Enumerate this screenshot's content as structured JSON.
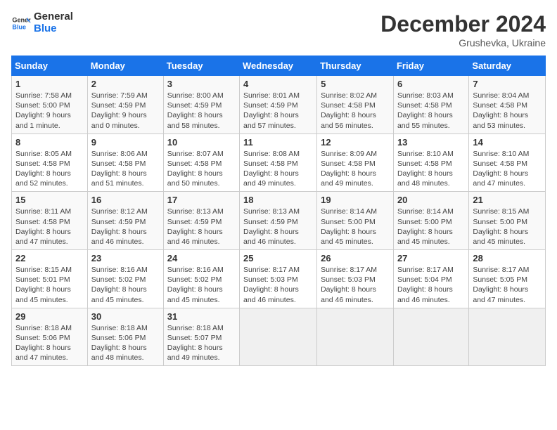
{
  "header": {
    "logo_line1": "General",
    "logo_line2": "Blue",
    "month": "December 2024",
    "location": "Grushevka, Ukraine"
  },
  "days_of_week": [
    "Sunday",
    "Monday",
    "Tuesday",
    "Wednesday",
    "Thursday",
    "Friday",
    "Saturday"
  ],
  "weeks": [
    [
      {
        "day": 1,
        "detail": "Sunrise: 7:58 AM\nSunset: 5:00 PM\nDaylight: 9 hours\nand 1 minute."
      },
      {
        "day": 2,
        "detail": "Sunrise: 7:59 AM\nSunset: 4:59 PM\nDaylight: 9 hours\nand 0 minutes."
      },
      {
        "day": 3,
        "detail": "Sunrise: 8:00 AM\nSunset: 4:59 PM\nDaylight: 8 hours\nand 58 minutes."
      },
      {
        "day": 4,
        "detail": "Sunrise: 8:01 AM\nSunset: 4:59 PM\nDaylight: 8 hours\nand 57 minutes."
      },
      {
        "day": 5,
        "detail": "Sunrise: 8:02 AM\nSunset: 4:58 PM\nDaylight: 8 hours\nand 56 minutes."
      },
      {
        "day": 6,
        "detail": "Sunrise: 8:03 AM\nSunset: 4:58 PM\nDaylight: 8 hours\nand 55 minutes."
      },
      {
        "day": 7,
        "detail": "Sunrise: 8:04 AM\nSunset: 4:58 PM\nDaylight: 8 hours\nand 53 minutes."
      }
    ],
    [
      {
        "day": 8,
        "detail": "Sunrise: 8:05 AM\nSunset: 4:58 PM\nDaylight: 8 hours\nand 52 minutes."
      },
      {
        "day": 9,
        "detail": "Sunrise: 8:06 AM\nSunset: 4:58 PM\nDaylight: 8 hours\nand 51 minutes."
      },
      {
        "day": 10,
        "detail": "Sunrise: 8:07 AM\nSunset: 4:58 PM\nDaylight: 8 hours\nand 50 minutes."
      },
      {
        "day": 11,
        "detail": "Sunrise: 8:08 AM\nSunset: 4:58 PM\nDaylight: 8 hours\nand 49 minutes."
      },
      {
        "day": 12,
        "detail": "Sunrise: 8:09 AM\nSunset: 4:58 PM\nDaylight: 8 hours\nand 49 minutes."
      },
      {
        "day": 13,
        "detail": "Sunrise: 8:10 AM\nSunset: 4:58 PM\nDaylight: 8 hours\nand 48 minutes."
      },
      {
        "day": 14,
        "detail": "Sunrise: 8:10 AM\nSunset: 4:58 PM\nDaylight: 8 hours\nand 47 minutes."
      }
    ],
    [
      {
        "day": 15,
        "detail": "Sunrise: 8:11 AM\nSunset: 4:58 PM\nDaylight: 8 hours\nand 47 minutes."
      },
      {
        "day": 16,
        "detail": "Sunrise: 8:12 AM\nSunset: 4:59 PM\nDaylight: 8 hours\nand 46 minutes."
      },
      {
        "day": 17,
        "detail": "Sunrise: 8:13 AM\nSunset: 4:59 PM\nDaylight: 8 hours\nand 46 minutes."
      },
      {
        "day": 18,
        "detail": "Sunrise: 8:13 AM\nSunset: 4:59 PM\nDaylight: 8 hours\nand 46 minutes."
      },
      {
        "day": 19,
        "detail": "Sunrise: 8:14 AM\nSunset: 5:00 PM\nDaylight: 8 hours\nand 45 minutes."
      },
      {
        "day": 20,
        "detail": "Sunrise: 8:14 AM\nSunset: 5:00 PM\nDaylight: 8 hours\nand 45 minutes."
      },
      {
        "day": 21,
        "detail": "Sunrise: 8:15 AM\nSunset: 5:00 PM\nDaylight: 8 hours\nand 45 minutes."
      }
    ],
    [
      {
        "day": 22,
        "detail": "Sunrise: 8:15 AM\nSunset: 5:01 PM\nDaylight: 8 hours\nand 45 minutes."
      },
      {
        "day": 23,
        "detail": "Sunrise: 8:16 AM\nSunset: 5:02 PM\nDaylight: 8 hours\nand 45 minutes."
      },
      {
        "day": 24,
        "detail": "Sunrise: 8:16 AM\nSunset: 5:02 PM\nDaylight: 8 hours\nand 45 minutes."
      },
      {
        "day": 25,
        "detail": "Sunrise: 8:17 AM\nSunset: 5:03 PM\nDaylight: 8 hours\nand 46 minutes."
      },
      {
        "day": 26,
        "detail": "Sunrise: 8:17 AM\nSunset: 5:03 PM\nDaylight: 8 hours\nand 46 minutes."
      },
      {
        "day": 27,
        "detail": "Sunrise: 8:17 AM\nSunset: 5:04 PM\nDaylight: 8 hours\nand 46 minutes."
      },
      {
        "day": 28,
        "detail": "Sunrise: 8:17 AM\nSunset: 5:05 PM\nDaylight: 8 hours\nand 47 minutes."
      }
    ],
    [
      {
        "day": 29,
        "detail": "Sunrise: 8:18 AM\nSunset: 5:06 PM\nDaylight: 8 hours\nand 47 minutes."
      },
      {
        "day": 30,
        "detail": "Sunrise: 8:18 AM\nSunset: 5:06 PM\nDaylight: 8 hours\nand 48 minutes."
      },
      {
        "day": 31,
        "detail": "Sunrise: 8:18 AM\nSunset: 5:07 PM\nDaylight: 8 hours\nand 49 minutes."
      },
      null,
      null,
      null,
      null
    ]
  ]
}
